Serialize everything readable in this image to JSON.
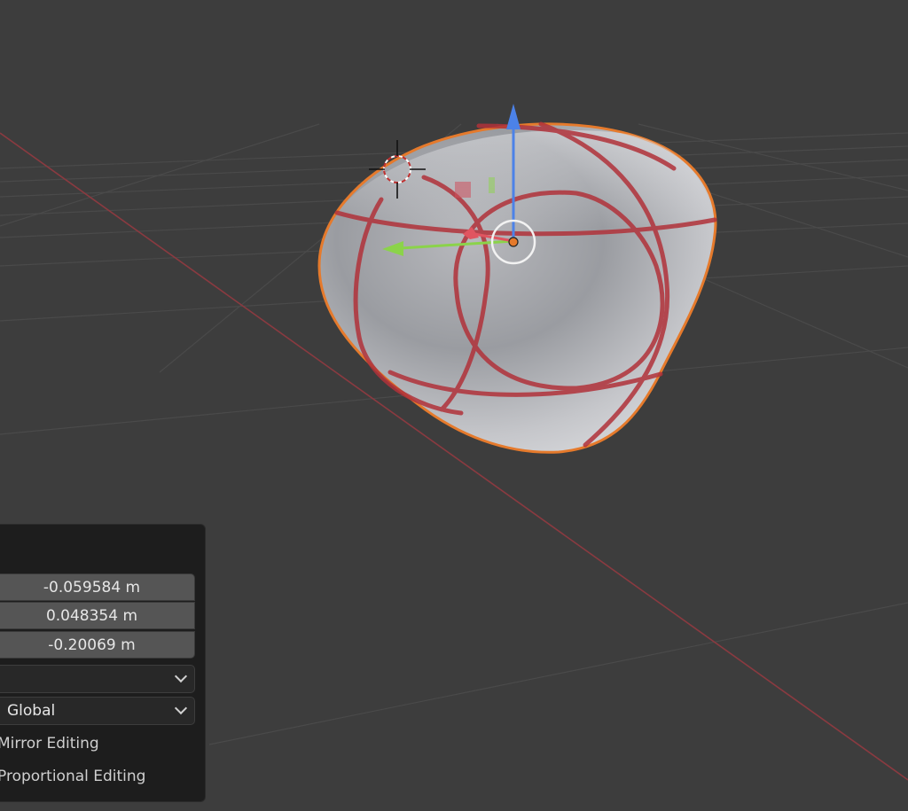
{
  "viewport": {
    "background": "#3d3d3d",
    "object_name": "selected-mesh-object",
    "outline_color": "#e57a2c",
    "axis_colors": {
      "x": "#c64952",
      "y": "#8bd34a",
      "z": "#4c82e8"
    }
  },
  "operator_panel": {
    "location": {
      "x": "-0.059584 m",
      "y": "0.048354 m",
      "z": "-0.20069 m"
    },
    "dropdown_empty": {
      "value": ""
    },
    "orientation": {
      "value": "Global"
    },
    "options": {
      "mirror_label": "Mirror Editing",
      "proportional_label": "Proportional Editing"
    }
  }
}
